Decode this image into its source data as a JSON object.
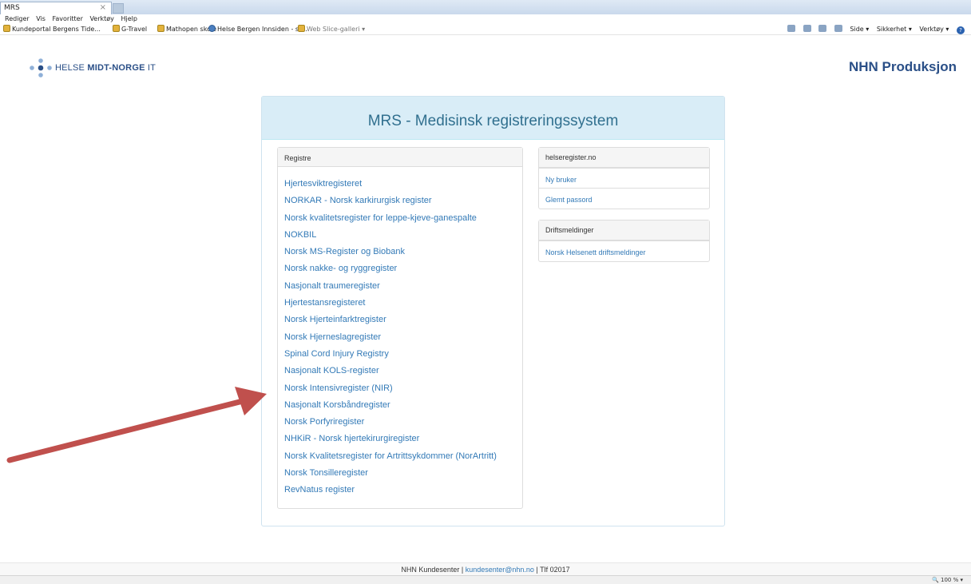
{
  "browser": {
    "tab_title": "MRS",
    "tab_close": "×",
    "menu": [
      "Rediger",
      "Vis",
      "Favoritter",
      "Verktøy",
      "Hjelp"
    ],
    "favorites": [
      {
        "label": "Kundeportal Bergens Tide...",
        "icon": "page-icon"
      },
      {
        "label": "G-Travel",
        "icon": "page-icon"
      },
      {
        "label": "Mathopen skole",
        "icon": "page-icon"
      },
      {
        "label": "Helse Bergen Innsiden - st...",
        "icon": "helse-icon"
      },
      {
        "label": "Web Slice-galleri ▾",
        "icon": "page-icon"
      }
    ],
    "commands": {
      "side": "Side ▾",
      "sikkerhet": "Sikkerhet ▾",
      "verktoy": "Verktøy ▾"
    },
    "zoom": "100 %"
  },
  "header": {
    "logo_prefix": "HELSE",
    "logo_bold": "MIDT-NORGE",
    "logo_suffix": "IT",
    "environment": "NHN Produksjon",
    "brand_color": "#2a4f87"
  },
  "main": {
    "title": "MRS - Medisinsk registreringssystem",
    "registers_heading": "Registre",
    "registers": [
      "Hjertesviktregisteret",
      "NORKAR - Norsk karkirurgisk register",
      "Norsk kvalitetsregister for leppe-kjeve-ganespalte",
      "NOKBIL",
      "Norsk MS-Register og Biobank",
      "Norsk nakke- og ryggregister",
      "Nasjonalt traumeregister",
      "Hjertestansregisteret",
      "Norsk Hjerteinfarktregister",
      "Norsk Hjerneslagregister",
      "Spinal Cord Injury Registry",
      "Nasjonalt KOLS-register",
      "Norsk Intensivregister (NIR)",
      "Nasjonalt Korsbåndregister",
      "Norsk Porfyriregister",
      "NHKiR - Norsk hjertekirurgiregister",
      "Norsk Kvalitetsregister for Artrittsykdommer (NorArtritt)",
      "Norsk Tonsilleregister",
      "RevNatus register"
    ],
    "helseregister": {
      "heading": "helseregister.no",
      "new_user": "Ny bruker",
      "forgot_password": "Glemt passord"
    },
    "driftsmeldinger": {
      "heading": "Driftsmeldinger",
      "link": "Norsk Helsenett driftsmeldinger"
    },
    "link_color": "#337ab7",
    "heading_bg": "#d9edf7",
    "arrow_color": "#c0504d"
  },
  "footer": {
    "text_before": "NHN Kundesenter |",
    "email": "kundesenter@nhn.no",
    "text_after": "| Tlf 02017"
  }
}
